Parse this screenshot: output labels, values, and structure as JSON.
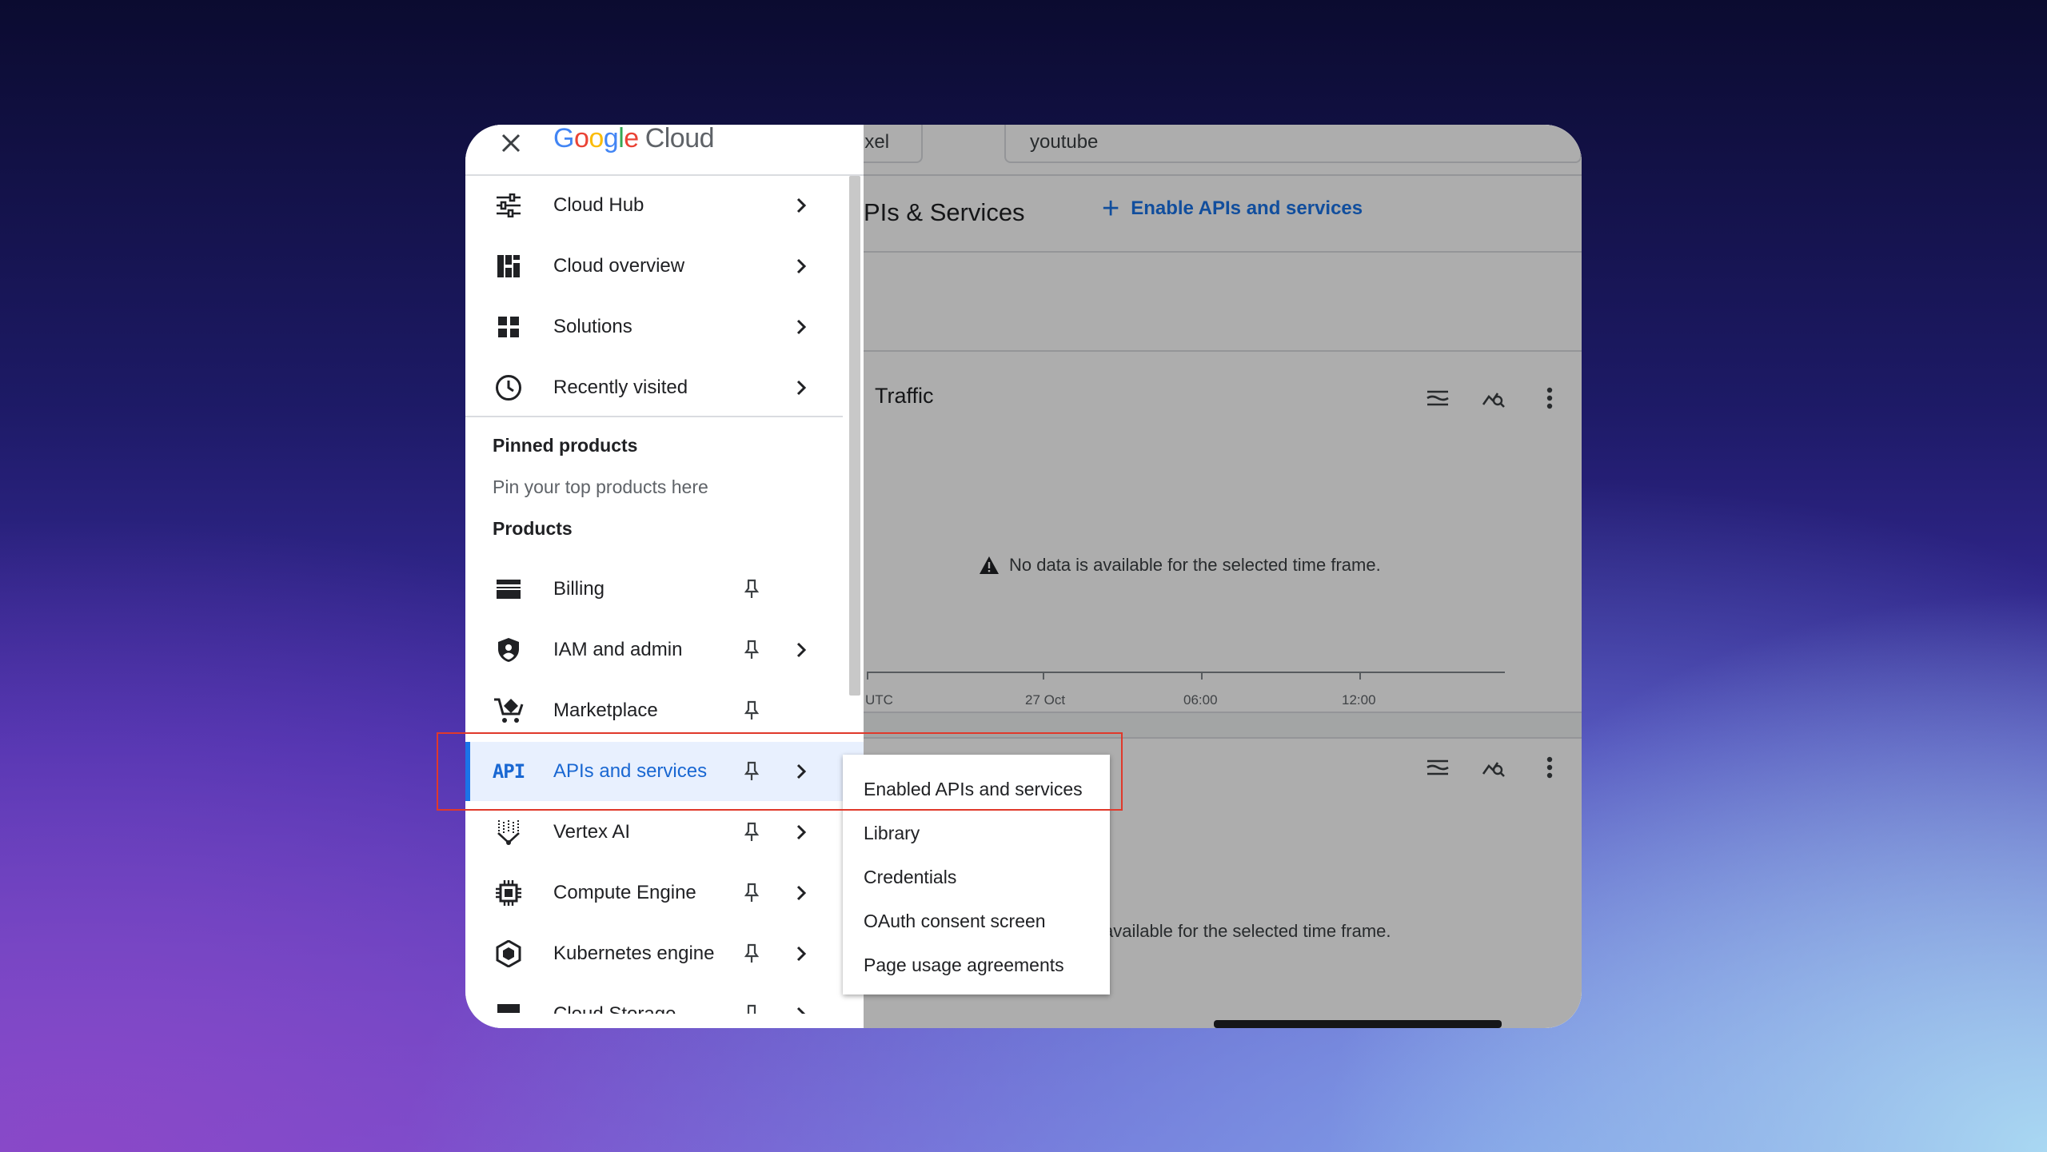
{
  "header": {
    "logo_google": "Google",
    "logo_cloud": "Cloud",
    "project_tab": "Pixel",
    "search_value": "youtube"
  },
  "page": {
    "title": "PIs & Services",
    "enable_button": "Enable APIs and services"
  },
  "traffic_card": {
    "title": "Traffic",
    "no_data": "No data is available for the selected time frame.",
    "axis_ticks": [
      "UTC",
      "27 Oct",
      "06:00",
      "12:00"
    ]
  },
  "second_card": {
    "no_data_partial": "available for the selected time frame."
  },
  "nav": {
    "top_items": [
      {
        "label": "Cloud Hub",
        "icon": "tune-icon"
      },
      {
        "label": "Cloud overview",
        "icon": "dashboard-icon"
      },
      {
        "label": "Solutions",
        "icon": "grid-icon"
      },
      {
        "label": "Recently visited",
        "icon": "clock-icon"
      }
    ],
    "pinned_heading": "Pinned products",
    "pinned_hint": "Pin your top products here",
    "products_heading": "Products",
    "products": [
      {
        "label": "Billing",
        "icon": "billing-icon"
      },
      {
        "label": "IAM and admin",
        "icon": "shield-icon"
      },
      {
        "label": "Marketplace",
        "icon": "cart-icon"
      },
      {
        "label": "APIs and services",
        "icon": "api-icon",
        "icon_text": "API"
      },
      {
        "label": "Vertex AI",
        "icon": "vertex-icon"
      },
      {
        "label": "Compute Engine",
        "icon": "chip-icon"
      },
      {
        "label": "Kubernetes engine",
        "icon": "kubernetes-icon"
      },
      {
        "label": "Cloud Storage",
        "icon": "storage-icon"
      }
    ]
  },
  "flyout": {
    "items": [
      "Enabled APIs and services",
      "Library",
      "Credentials",
      "OAuth consent screen",
      "Page usage agreements"
    ]
  },
  "colors": {
    "accent": "#1a73e8",
    "active_bg": "#e8f0fe",
    "highlight": "#e0392b"
  }
}
